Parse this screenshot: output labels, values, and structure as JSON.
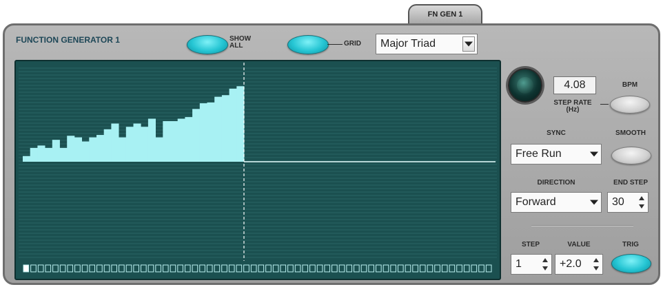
{
  "tab": {
    "label": "FN GEN 1"
  },
  "header": {
    "title": "FUNCTION GENERATOR 1",
    "show_all_label": "SHOW\nALL",
    "grid_label": "GRID",
    "grid_select": "Major Triad"
  },
  "controls": {
    "step_rate_value": "4.08",
    "step_rate_label": "STEP RATE\n(Hz)",
    "bpm_label": "BPM",
    "sync_label": "SYNC",
    "sync_value": "Free Run",
    "smooth_label": "SMOOTH",
    "direction_label": "DIRECTION",
    "direction_value": "Forward",
    "end_step_label": "END STEP",
    "end_step_value": "30",
    "step_label": "STEP",
    "step_value": "1",
    "value_label": "VALUE",
    "value_value": "+2.0",
    "trig_label": "TRIG"
  },
  "sequencer": {
    "total_steps": 64,
    "active_steps": 30,
    "levels": [
      0.07,
      0.17,
      0.2,
      0.17,
      0.27,
      0.17,
      0.32,
      0.3,
      0.25,
      0.3,
      0.33,
      0.4,
      0.47,
      0.3,
      0.43,
      0.47,
      0.43,
      0.53,
      0.3,
      0.5,
      0.5,
      0.53,
      0.55,
      0.65,
      0.72,
      0.73,
      0.8,
      0.82,
      0.9,
      0.93
    ]
  },
  "colors": {
    "bar": "#a8f1f3",
    "display_bg": "#1b5050",
    "grid_line": "#2a6565",
    "step_box": "#bdf2f2",
    "accent": "#25c5d3"
  }
}
